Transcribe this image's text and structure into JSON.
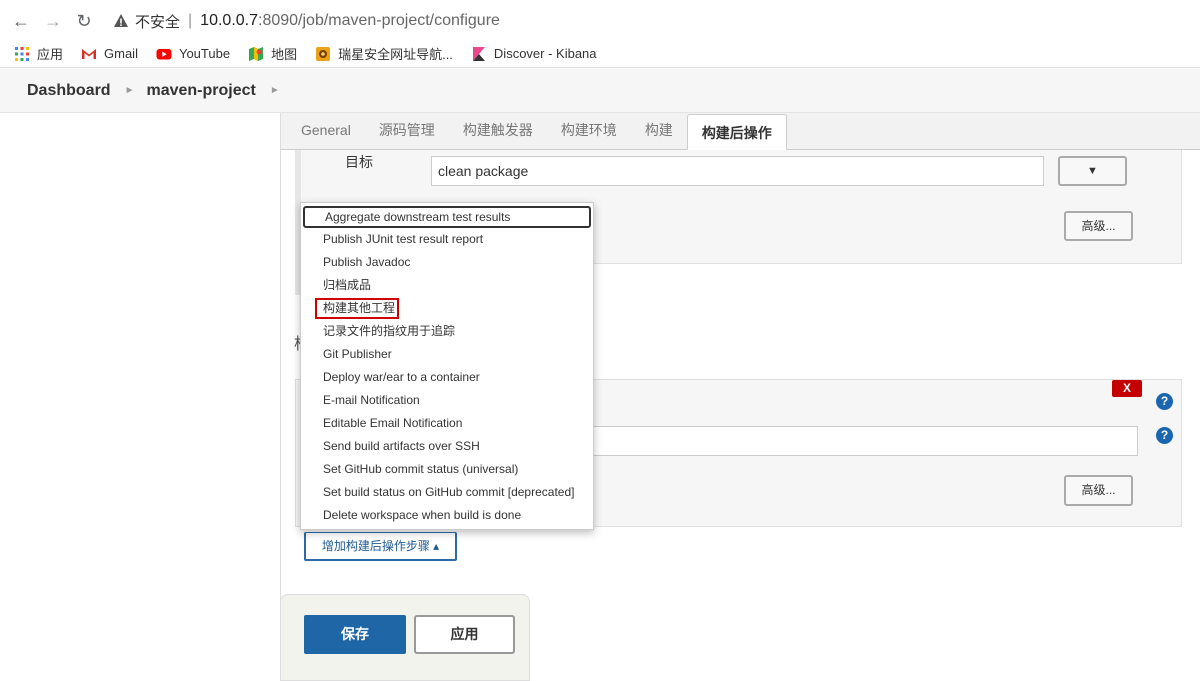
{
  "browser": {
    "security_label": "不安全",
    "url_host": "10.0.0.7",
    "url_rest": ":8090/job/maven-project/configure",
    "bookmarks": [
      {
        "label": "应用",
        "icon": "apps-grid-icon"
      },
      {
        "label": "Gmail",
        "icon": "gmail-icon"
      },
      {
        "label": "YouTube",
        "icon": "youtube-icon"
      },
      {
        "label": "地图",
        "icon": "maps-icon"
      },
      {
        "label": "瑞星安全网址导航...",
        "icon": "rising-icon"
      },
      {
        "label": "Discover - Kibana",
        "icon": "kibana-icon"
      }
    ],
    "colors": {
      "youtube": "#ff0000",
      "gmail": "#d93025",
      "kibana": "#e8488b"
    }
  },
  "breadcrumb": [
    "Dashboard",
    "maven-project"
  ],
  "tabs": [
    {
      "label": "General",
      "active": false
    },
    {
      "label": "源码管理",
      "active": false
    },
    {
      "label": "构建触发器",
      "active": false
    },
    {
      "label": "构建环境",
      "active": false
    },
    {
      "label": "构建",
      "active": false
    },
    {
      "label": "构建后操作",
      "active": true
    }
  ],
  "build_section": {
    "goal_label": "目标",
    "goal_value": "clean package",
    "dropdown_arrow": "▼",
    "advanced_label": "高级..."
  },
  "post_build": {
    "partial_heading": "构",
    "delete_label": "X",
    "help_icon": "?",
    "advanced_label": "高级...",
    "add_step_label": "增加构建后操作步骤 ▴"
  },
  "dropdown": {
    "items": [
      "Aggregate downstream test results",
      "Publish JUnit test result report",
      "Publish Javadoc",
      "归档成品",
      "构建其他工程",
      "记录文件的指纹用于追踪",
      "Git Publisher",
      "Deploy war/ear to a container",
      "E-mail Notification",
      "Editable Email Notification",
      "Send build artifacts over SSH",
      "Set GitHub commit status (universal)",
      "Set build status on GitHub commit [deprecated]",
      "Delete workspace when build is done"
    ],
    "highlighted": "构建其他工程"
  },
  "footer": {
    "save_label": "保存",
    "apply_label": "应用"
  }
}
